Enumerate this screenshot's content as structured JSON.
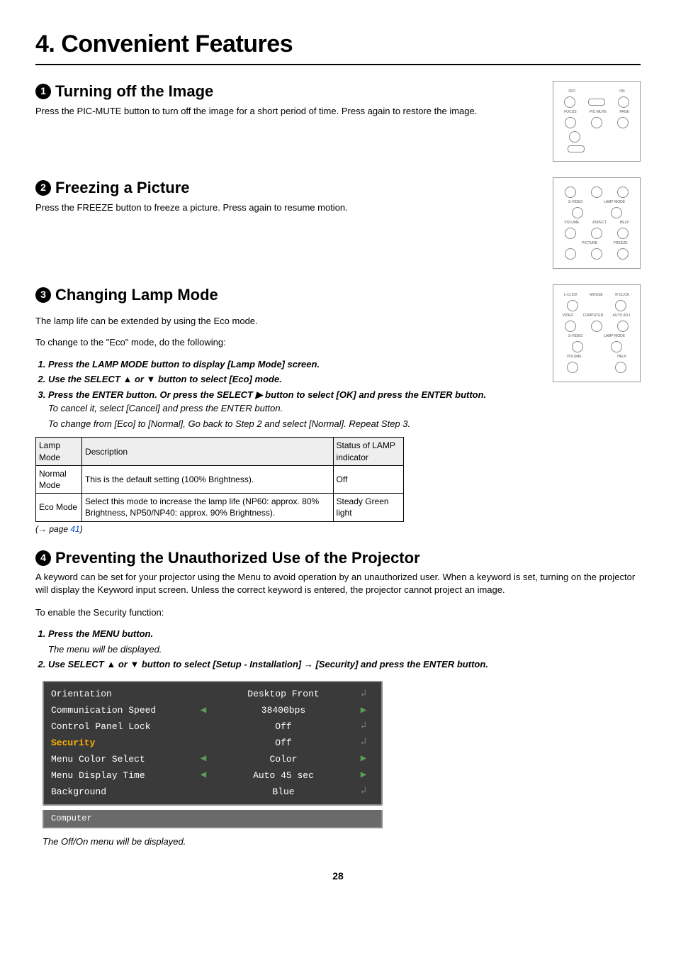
{
  "chapter_title": "4. Convenient Features",
  "sections": {
    "s1": {
      "num": "1",
      "title": "Turning off the Image",
      "body": "Press the PIC-MUTE button to turn off the image for a short period of time. Press again to restore the image."
    },
    "s2": {
      "num": "2",
      "title": "Freezing a Picture",
      "body": "Press the FREEZE button to freeze a picture. Press again to resume motion."
    },
    "s3": {
      "num": "3",
      "title": "Changing Lamp Mode",
      "intro1": "The lamp life can be extended by using the Eco mode.",
      "intro2": "To change to the \"Eco\" mode, do the following:",
      "steps": {
        "a": "Press the LAMP MODE button to display [Lamp Mode] screen.",
        "b": "Use the SELECT ▲ or ▼ button to select [Eco] mode.",
        "c": "Press the ENTER button. Or press the SELECT ▶ button to select [OK] and press the ENTER button.",
        "c_sub1": "To cancel it, select [Cancel] and press the ENTER button.",
        "c_sub2": "To change from [Eco] to [Normal], Go back to Step 2 and select [Normal]. Repeat Step 3."
      },
      "table": {
        "h1": "Lamp Mode",
        "h2": "Description",
        "h3": "Status of LAMP indicator",
        "r1c1": "Normal Mode",
        "r1c2": "This is the default setting (100% Brightness).",
        "r1c3": "Off",
        "r2c1": "Eco Mode",
        "r2c2": "Select this mode to increase the lamp life (NP60: approx. 80% Brightness, NP50/NP40: approx. 90% Brightness).",
        "r2c3": "Steady Green light"
      },
      "pagelink_prefix": "(→ page ",
      "pagelink_num": "41",
      "pagelink_suffix": ")"
    },
    "s4": {
      "num": "4",
      "title": "Preventing the Unauthorized Use of the Projector",
      "body": "A keyword can be set for your projector using the Menu to avoid operation by an unauthorized user. When a keyword is set, turning on the projector will display the Keyword input screen. Unless the correct keyword is entered, the projector cannot project an image.",
      "enable": "To enable the Security function:",
      "steps": {
        "a": "Press the MENU button.",
        "a_sub": "The menu will be displayed.",
        "b": "Use SELECT ▲ or ▼ button to select [Setup - Installation] → [Security] and press the ENTER button."
      },
      "menu": {
        "orientation_l": "Orientation",
        "orientation_v": "Desktop Front",
        "comm_l": "Communication Speed",
        "comm_v": "38400bps",
        "cpl_l": "Control Panel Lock",
        "cpl_v": "Off",
        "sec_l": "Security",
        "sec_v": "Off",
        "mcs_l": "Menu Color Select",
        "mcs_v": "Color",
        "mdt_l": "Menu Display Time",
        "mdt_v": "Auto 45 sec",
        "bg_l": "Background",
        "bg_v": "Blue",
        "footer": "Computer"
      },
      "caption": "The Off/On menu will be displayed."
    }
  },
  "remote_labels": {
    "off": "OFF",
    "on": "ON",
    "focus": "FOCUS",
    "picmute": "PIC-MUTE",
    "page": "PAGE",
    "svideo": "S-VIDEO",
    "lampmode": "LAMP MODE",
    "volume": "VOLUME",
    "aspect": "ASPECT",
    "help": "HELP",
    "picture": "PICTURE",
    "freeze": "FREEZE",
    "lclick": "L-CLICK",
    "mouse": "MOUSE",
    "rclick": "R-CLICK",
    "video": "VIDEO",
    "computer": "COMPUTER",
    "autoadj": "AUTO ADJ."
  },
  "chart_data": {
    "type": "table",
    "title": "Lamp Mode options",
    "columns": [
      "Lamp Mode",
      "Description",
      "Status of LAMP indicator"
    ],
    "rows": [
      [
        "Normal Mode",
        "This is the default setting (100% Brightness).",
        "Off"
      ],
      [
        "Eco Mode",
        "Select this mode to increase the lamp life (NP60: approx. 80% Brightness, NP50/NP40: approx. 90% Brightness).",
        "Steady Green light"
      ]
    ]
  },
  "page_number": "28"
}
